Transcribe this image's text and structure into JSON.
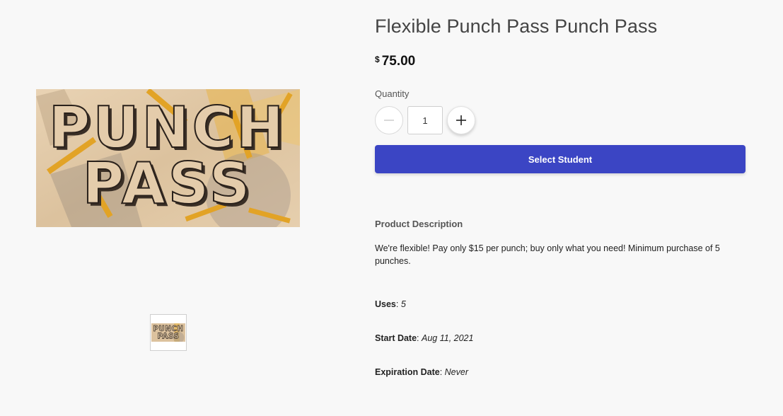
{
  "product": {
    "title": "Flexible Punch Pass Punch Pass",
    "currency_symbol": "$",
    "price": "75.00",
    "image_text": [
      "PUNCH",
      "PASS"
    ]
  },
  "quantity": {
    "label": "Quantity",
    "value": "1",
    "decrement_icon": "minus-icon",
    "increment_icon": "plus-icon"
  },
  "actions": {
    "select_student_label": "Select Student"
  },
  "description": {
    "heading": "Product Description",
    "text": "We're flexible! Pay only $15 per punch; buy only what you need! Minimum purchase of 5 punches."
  },
  "details": {
    "uses_label": "Uses",
    "uses_value": "5",
    "start_label": "Start Date",
    "start_value": "Aug 11, 2021",
    "expiration_label": "Expiration Date",
    "expiration_value": "Never"
  },
  "colors": {
    "accent": "#3b45c4",
    "background": "#f8f8f8"
  }
}
